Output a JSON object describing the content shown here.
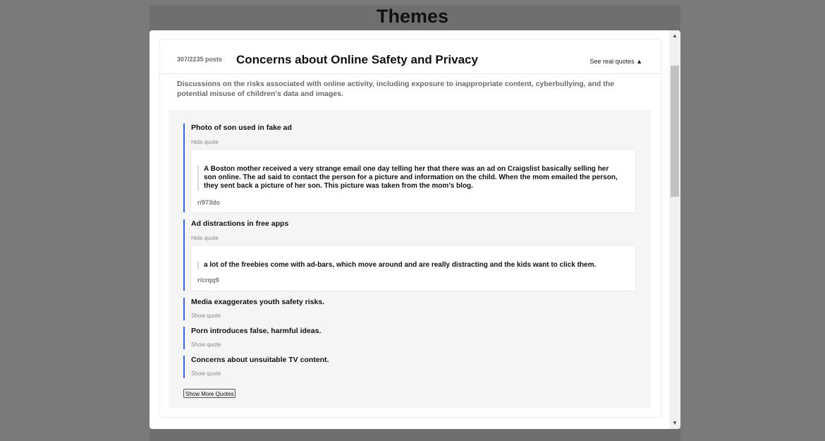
{
  "page": {
    "title": "Themes"
  },
  "theme": {
    "post_count": "307/2235 posts",
    "title": "Concerns about Online Safety and Privacy",
    "see_quotes_label": "See real quotes ▲",
    "description": "Discussions on the risks associated with online activity, including exposure to inappropriate content, cyberbullying, and the potential misuse of children's data and images."
  },
  "quotes": [
    {
      "title": "Photo of son used in fake ad",
      "toggle": "Hide quote",
      "expanded": true,
      "text": "A Boston mother received a very strange email one day telling her that there was an ad on Craigslist basically selling her son online. The ad said to contact the person for a picture and information on the child. When the mom emailed the person, they sent back a picture of her son. This picture was taken from the mom’s blog.",
      "source": "r/973do"
    },
    {
      "title": "Ad distractions in free apps",
      "toggle": "Hide quote",
      "expanded": true,
      "text": "a lot of the freebies come with ad-bars, which move around and are really distracting and the kids want to click them.",
      "source": "r/crqq9"
    },
    {
      "title": "Media exaggerates youth safety risks.",
      "toggle": "Show quote",
      "expanded": false
    },
    {
      "title": "Porn introduces false, harmful ideas.",
      "toggle": "Show quote",
      "expanded": false
    },
    {
      "title": "Concerns about unsuitable TV content.",
      "toggle": "Show quote",
      "expanded": false
    }
  ],
  "show_more_label": "Show More Quotes",
  "colors": {
    "accent_bar": "#3f63e0",
    "overlay": "#7a7a7a"
  },
  "icons": {
    "scroll_up": "triangle-up-icon",
    "scroll_down": "triangle-down-icon"
  }
}
